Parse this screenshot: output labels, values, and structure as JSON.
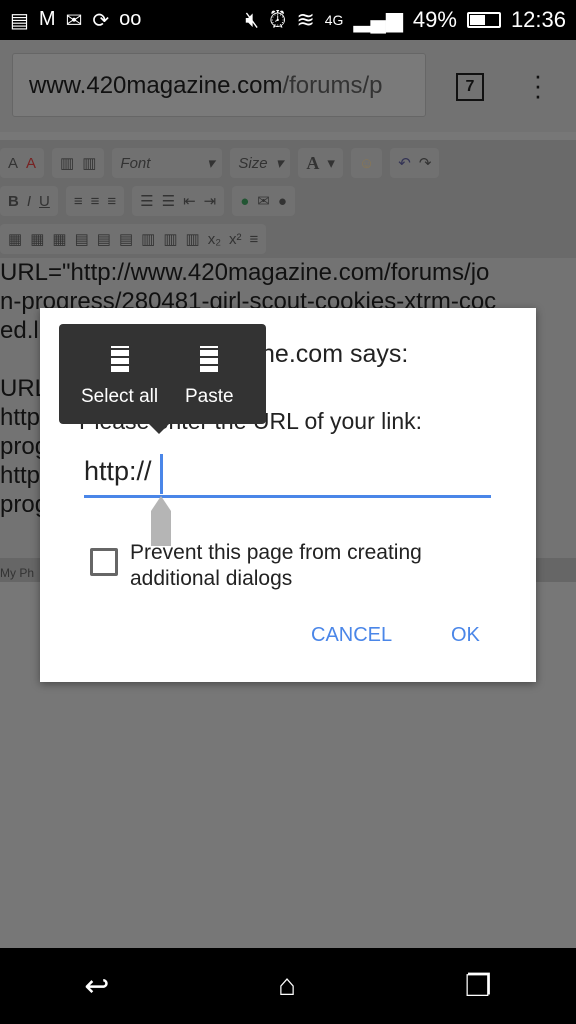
{
  "status_bar": {
    "battery": "49%",
    "battery_level": 0.49,
    "time": "12:36",
    "network": "4G"
  },
  "browser": {
    "url_host": "www.420magazine.com",
    "url_path": "/forums/p",
    "tab_count": "7"
  },
  "toolbar": {
    "font_label": "Font",
    "size_label": "Size"
  },
  "editor": {
    "lines": [
      "URL=\"http://www.420magazine.com/forums/jo",
      "n-progress/280481-girl-scout-cookies-xtrm-coc",
      "ed.l                                                    URL",
      "",
      "URL",
      "http                                                 nals",
      "prog                                                  tml",
      "http                                                 nals",
      "prog                                                  tml"
    ],
    "footer": "My Ph"
  },
  "dialog": {
    "title": "www.420magazine.com says:",
    "message": "Please enter the URL of your link:",
    "input_value": "http://",
    "checkbox_label": "Prevent this page from creating additional dialogs",
    "checkbox_checked": false,
    "cancel": "CANCEL",
    "ok": "OK"
  },
  "context_menu": {
    "select_all": "Select all",
    "paste": "Paste"
  },
  "colors": {
    "accent": "#4a86e8"
  }
}
